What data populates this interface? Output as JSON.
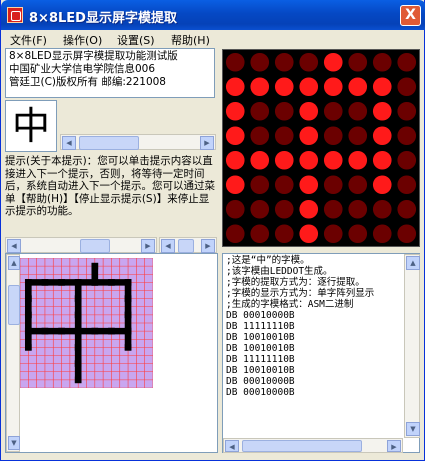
{
  "window": {
    "title": "8×8LED显示屏字模提取",
    "close_glyph": "X"
  },
  "menu": [
    {
      "label": "文件(F)"
    },
    {
      "label": "操作(O)"
    },
    {
      "label": "设置(S)"
    },
    {
      "label": "帮助(H)"
    }
  ],
  "info_lines": [
    "8×8LED显示屏字模提取功能测试版",
    "中国矿业大学信电学院信息006",
    "管廷卫(C)版权所有  邮编:221008"
  ],
  "character": "中",
  "hint_text": "提示(关于本提示)：您可以单击提示内容以直接进入下一个提示，否则，将等待一定时间后，系统自动进入下一个提示。您可以通过菜单【帮助(H)】【停止显示提示(S)】来停止显示提示的功能。",
  "led_matrix": [
    [
      0,
      0,
      0,
      0,
      1,
      0,
      0,
      0
    ],
    [
      1,
      1,
      1,
      1,
      1,
      1,
      1,
      0
    ],
    [
      1,
      0,
      0,
      1,
      0,
      0,
      1,
      0
    ],
    [
      1,
      0,
      0,
      1,
      0,
      0,
      1,
      0
    ],
    [
      1,
      1,
      1,
      1,
      1,
      1,
      1,
      0
    ],
    [
      1,
      0,
      0,
      1,
      0,
      0,
      1,
      0
    ],
    [
      0,
      0,
      0,
      1,
      0,
      0,
      0,
      0
    ],
    [
      0,
      0,
      0,
      1,
      0,
      0,
      0,
      0
    ]
  ],
  "colors": {
    "led_on": "#ff1a1a",
    "led_off": "#6b0000",
    "grid_bg": "#c9a6f0",
    "grid_line": "#ff3b3b",
    "pixel": "#000000"
  },
  "code_lines": [
    ";这是“中”的字模。",
    ";该字模由LEDDOT生成。",
    ";字模的提取方式为：逐行提取。",
    ";字模的显示方式为：单字阵列显示",
    ";生成的字模格式：ASM二进制",
    "DB 00010000B",
    "DB 11111110B",
    "DB 10010010B",
    "DB 10010010B",
    "DB 11111110B",
    "DB 10010010B",
    "DB 00010000B",
    "DB 00010000B"
  ],
  "scroll_arrows": {
    "left": "◀",
    "right": "▶",
    "up": "▲",
    "down": "▼"
  }
}
